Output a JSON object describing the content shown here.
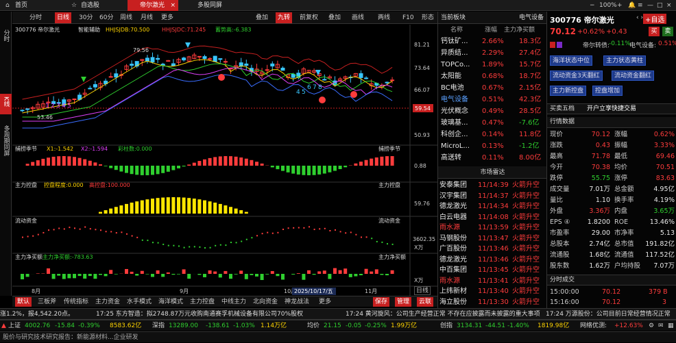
{
  "tabs": [
    {
      "label": "首页"
    },
    {
      "label": "自选股"
    },
    {
      "label": "帝尔激光",
      "active": true
    },
    {
      "label": "多股同屏"
    }
  ],
  "window": {
    "zoom": "100%"
  },
  "left_tabs": [
    "分时",
    "K线",
    "多周期同屏"
  ],
  "toolbar": {
    "items": [
      "分时",
      "日线",
      "30分",
      "60分",
      "周线",
      "月线",
      "更多"
    ],
    "selected": "日线",
    "right_items": [
      "叠加",
      "九转",
      "前复权",
      "叠加",
      "画线",
      "两线",
      "F10",
      "形态"
    ]
  },
  "chart": {
    "stock": "300776 帝尔激光",
    "assist": "智能辅助",
    "indicator_line": "HHJSJDB:70.500",
    "indicator_line2": "HHJSJDC:71.245",
    "indicator_line3": "蓄势高:-6.383",
    "price_axis": [
      "81.21",
      "73.64",
      "66.07",
      "59.54",
      "50.93"
    ],
    "current_price": "59.54",
    "annotation_high": "79.56",
    "annotation_low": "53.46",
    "nine_turn_up": [
      "1",
      "2",
      "3",
      "4",
      "5"
    ],
    "nine_turn_down": [
      "4",
      "5",
      "6",
      "7",
      "8"
    ],
    "months": [
      "8月",
      "9月",
      "10月",
      "11月"
    ],
    "cursor_date": "2025/10/17/五",
    "panel1": {
      "title": "捕捞季节",
      "x1": "X1:-1.542",
      "x2": "X2:-1.594",
      "col": "彩柱数:0.000",
      "right": "捕捞季节",
      "axis": "0.88"
    },
    "panel2": {
      "title": "主力控盘",
      "a": "控盘程度:0.000",
      "b": "高控盘:100.000",
      "right": "主力控盘",
      "axis": "59.76"
    },
    "panel3": {
      "title": "流动资金",
      "right": "流动资金",
      "axis": "3602.35",
      "unit": "X万"
    },
    "panel4": {
      "title": "主力净买额",
      "a": "主力净买额:-783.63",
      "right": "主力净买额",
      "unit": "X万"
    }
  },
  "bottom_tabs": [
    "默认",
    "三板斧",
    "传统指标",
    "主力资金",
    "水手模式",
    "海洋模式",
    "主力控盘",
    "中线主力",
    "北向资金",
    "神龙战法",
    "更多"
  ],
  "bottom_right": [
    "保存",
    "管理",
    "云联"
  ],
  "bottom_period": "日线",
  "sector": {
    "header": "当前板块",
    "header_right": "电气设备",
    "cols": [
      "名称",
      "涨幅",
      "主力净买额"
    ],
    "rows": [
      {
        "name": "钙钛矿...",
        "pct": "2.66%",
        "net": "18.3亿",
        "pc": "red",
        "nc": "red",
        "name_c": "white"
      },
      {
        "name": "异质结...",
        "pct": "2.29%",
        "net": "27.4亿",
        "pc": "red",
        "nc": "red",
        "name_c": "white"
      },
      {
        "name": "TOPCo...",
        "pct": "1.89%",
        "net": "15.7亿",
        "pc": "red",
        "nc": "red",
        "name_c": "white"
      },
      {
        "name": "太阳能",
        "pct": "0.68%",
        "net": "18.7亿",
        "pc": "red",
        "nc": "red",
        "name_c": "white"
      },
      {
        "name": "BC电池",
        "pct": "0.67%",
        "net": "2.15亿",
        "pc": "red",
        "nc": "red",
        "name_c": "white"
      },
      {
        "name": "电气设备",
        "pct": "0.51%",
        "net": "42.3亿",
        "pc": "red",
        "nc": "red",
        "name_c": "blue"
      },
      {
        "name": "光伏概念",
        "pct": "0.49%",
        "net": "28.5亿",
        "pc": "red",
        "nc": "red",
        "name_c": "white"
      },
      {
        "name": "玻璃基...",
        "pct": "0.47%",
        "net": "-7.6亿",
        "pc": "red",
        "nc": "green",
        "name_c": "white"
      },
      {
        "name": "科创企...",
        "pct": "0.14%",
        "net": "11.8亿",
        "pc": "red",
        "nc": "red",
        "name_c": "white"
      },
      {
        "name": "MicroL...",
        "pct": "0.13%",
        "net": "-1.2亿",
        "pc": "red",
        "nc": "green",
        "name_c": "white"
      },
      {
        "name": "高送转",
        "pct": "0.11%",
        "net": "8.00亿",
        "pc": "red",
        "nc": "red",
        "name_c": "white"
      }
    ],
    "radar_title": "市场雷达",
    "radar": [
      {
        "name": "安泰集团",
        "time": "11/14:39",
        "ev": "火箭升空",
        "c": "white"
      },
      {
        "name": "汉宇集团",
        "time": "11/14:37",
        "ev": "火箭升空",
        "c": "white"
      },
      {
        "name": "德龙激光",
        "time": "11/14:34",
        "ev": "火箭升空",
        "c": "white"
      },
      {
        "name": "白云电器",
        "time": "11/14:08",
        "ev": "火箭升空",
        "c": "white"
      },
      {
        "name": "雨水源",
        "time": "11/13:59",
        "ev": "火箭升空",
        "c": "red"
      },
      {
        "name": "马钢股份",
        "time": "11/13:47",
        "ev": "火箭升空",
        "c": "white"
      },
      {
        "name": "广百股份",
        "time": "11/13:46",
        "ev": "火箭升空",
        "c": "white"
      },
      {
        "name": "德龙激光",
        "time": "11/13:46",
        "ev": "火箭升空",
        "c": "white"
      },
      {
        "name": "中百集团",
        "time": "11/13:45",
        "ev": "火箭升空",
        "c": "white"
      },
      {
        "name": "雨水源",
        "time": "11/13:41",
        "ev": "火箭升空",
        "c": "red"
      },
      {
        "name": "上纬新材",
        "time": "11/13:40",
        "ev": "火箭升空",
        "c": "white"
      },
      {
        "name": "海立股份",
        "time": "11/13:30",
        "ev": "火箭升空",
        "c": "white"
      }
    ]
  },
  "quote": {
    "code_name": "300776 帝尔激光",
    "price": "70.12",
    "chg_pct": "+0.62%",
    "chg": "+0.43",
    "add_label": "+自选",
    "buy": "买",
    "sell": "卖",
    "convert": "帝尔转债:",
    "convert_pct": "-0.11%",
    "industry": "电气设备:",
    "industry_pct": "0.51%",
    "tags": [
      "海洋状态中位",
      "主力状态黄柱",
      "流动资金3天翻红",
      "流动资金翻红",
      "主力新控盘",
      "控盘增加"
    ],
    "five_tab": "买卖五档",
    "open_acct": "开户立享快捷交易",
    "section": "行情数据",
    "rows": [
      [
        "现价",
        "70.12",
        "涨幅",
        "0.62%"
      ],
      [
        "涨跌",
        "0.43",
        "振幅",
        "3.33%"
      ],
      [
        "最高",
        "71.78",
        "最低",
        "69.46"
      ],
      [
        "今开",
        "70.38",
        "均价",
        "70.51"
      ],
      [
        "跌停",
        "55.75",
        "涨停",
        "83.63"
      ],
      [
        "成交量",
        "7.01万",
        "总金额",
        "4.95亿"
      ],
      [
        "量比",
        "1.10",
        "换手率",
        "4.19%"
      ],
      [
        "外盘",
        "3.36万",
        "内盘",
        "3.65万"
      ],
      [
        "EPS ④",
        "1.8200",
        "ROE",
        "13.46%"
      ],
      [
        "市盈率",
        "29.00",
        "市净率",
        "5.13"
      ],
      [
        "总股本",
        "2.74亿",
        "总市值",
        "191.82亿"
      ],
      [
        "流通股",
        "1.68亿",
        "流通值",
        "117.52亿"
      ],
      [
        "股东数",
        "1.62万",
        "户均持股",
        "7.07万"
      ]
    ],
    "fenshi_title": "分时成交",
    "fenshi": [
      [
        "15:00:00",
        "70.12",
        "379 B"
      ],
      [
        "15:16:00",
        "70.12",
        "3"
      ]
    ],
    "bottom_note": "股价与研究技术研究报告：新能源材料...企业研发"
  },
  "news": {
    "left": "涨1.2%，报4,542.20点。",
    "n1": "17:25 东方智造：拟2748.87万元收购南通赛孚机械设备有限公司70%股权",
    "n2": "17:24 黄河旋风：公司生产经营正常 不存在应披露而未披露的重大事项",
    "n3": "17:24 万源股份：公司目前日常经营情况正常"
  },
  "ticker": [
    {
      "name": "上证",
      "val": "4002.76",
      "chg": "-15.84",
      "pct": "-0.39%",
      "amt": "8583.62亿"
    },
    {
      "name": "深指",
      "val": "13289.00",
      "chg": "-138.61",
      "pct": "-1.03%",
      "amt": "1.14万亿"
    },
    {
      "name": "均价",
      "val": "21.15",
      "chg": "-0.05",
      "pct": "-0.25%",
      "amt": "1.99万亿"
    },
    {
      "name": "创指",
      "val": "3134.31",
      "chg": "-44.51",
      "pct": "-1.40%",
      "amt": "1819.98亿"
    }
  ],
  "status": {
    "network": "网络优测:",
    "net_val": "+12.63%"
  }
}
